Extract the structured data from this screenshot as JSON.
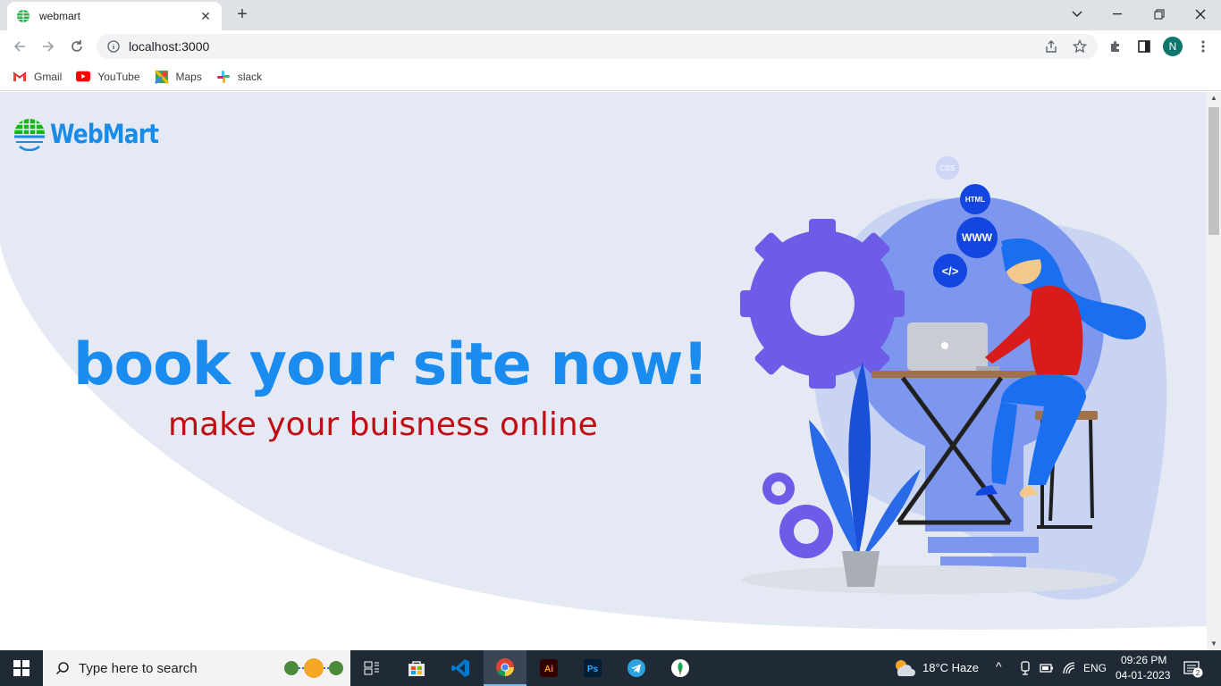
{
  "browser": {
    "tab_title": "webmart",
    "url": "localhost:3000",
    "profile_initial": "N",
    "bookmarks": [
      {
        "label": "Gmail",
        "icon": "gmail-icon"
      },
      {
        "label": "YouTube",
        "icon": "youtube-icon"
      },
      {
        "label": "Maps",
        "icon": "maps-icon"
      },
      {
        "label": "slack",
        "icon": "slack-icon"
      }
    ]
  },
  "page": {
    "logo_text": "WebMart",
    "headline": "book your site now!",
    "subline": "make your buisness online",
    "illustration_badges": [
      "CSS",
      "HTML",
      "WWW",
      "</>"
    ]
  },
  "taskbar": {
    "search_placeholder": "Type here to search",
    "weather": "18°C  Haze",
    "language": "ENG",
    "time": "09:26 PM",
    "date": "04-01-2023",
    "notification_count": "2"
  },
  "colors": {
    "brand_blue": "#1a8cf0",
    "subline_red": "#c00d13",
    "hero_bg": "#e4e9f3",
    "illus_purple": "#6c5ce7"
  }
}
